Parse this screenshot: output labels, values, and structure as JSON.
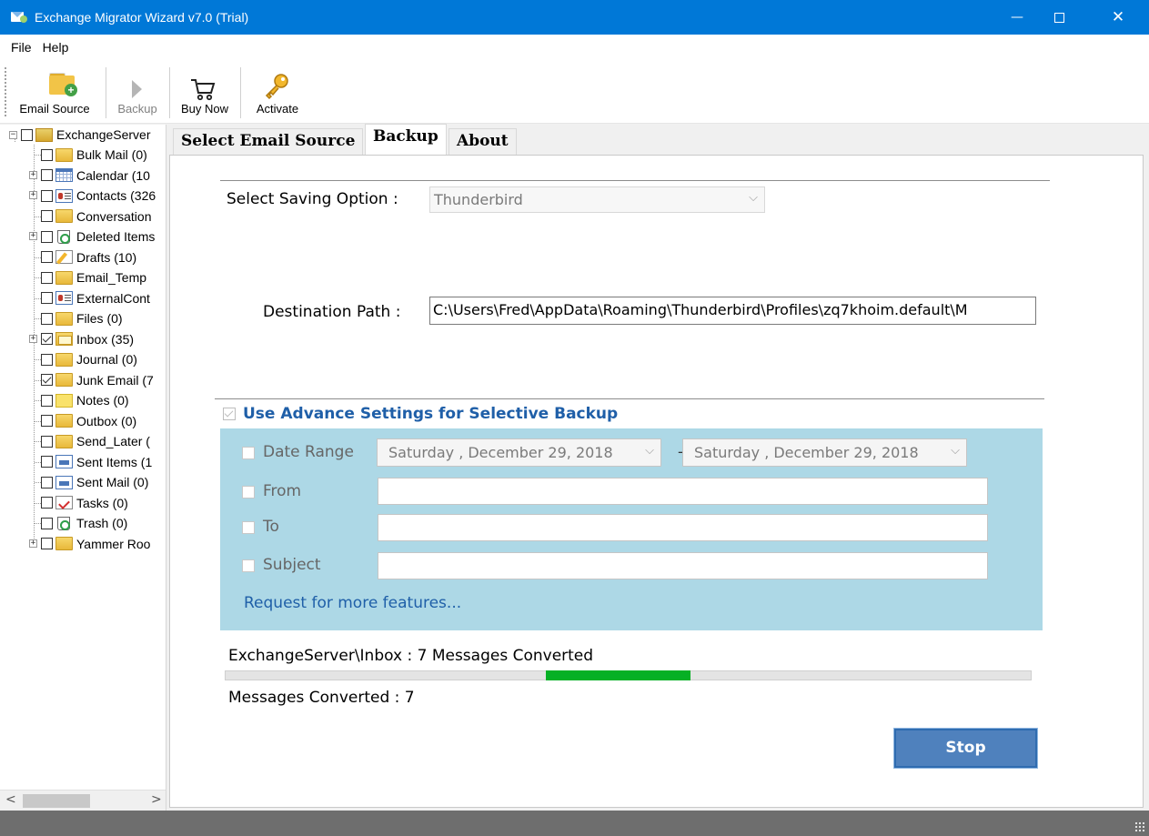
{
  "window": {
    "title": "Exchange Migrator Wizard v7.0 (Trial)",
    "accent_color": "#0078d7"
  },
  "menu": [
    "File",
    "Help"
  ],
  "toolbar": {
    "email_source": "Email Source",
    "backup": "Backup",
    "buy_now": "Buy Now",
    "activate": "Activate"
  },
  "tree": {
    "root": "ExchangeServer",
    "items": [
      {
        "label": "Bulk Mail (0)",
        "icon": "folder-icon",
        "checked": false
      },
      {
        "label": "Calendar (10",
        "icon": "calendar-icon",
        "checked": false
      },
      {
        "label": "Contacts (326",
        "icon": "contacts-icon",
        "checked": false
      },
      {
        "label": "Conversation",
        "icon": "folder-icon",
        "checked": false
      },
      {
        "label": "Deleted Items",
        "icon": "trash-icon",
        "checked": false
      },
      {
        "label": "Drafts (10)",
        "icon": "drafts-icon",
        "checked": false
      },
      {
        "label": "Email_Temp",
        "icon": "folder-icon",
        "checked": false
      },
      {
        "label": "ExternalCont",
        "icon": "contacts-icon",
        "checked": false
      },
      {
        "label": "Files (0)",
        "icon": "folder-icon",
        "checked": false
      },
      {
        "label": "Inbox (35)",
        "icon": "inbox-icon",
        "checked": true
      },
      {
        "label": "Journal (0)",
        "icon": "folder-icon",
        "checked": false
      },
      {
        "label": "Junk Email (7",
        "icon": "folder-icon",
        "checked": true
      },
      {
        "label": "Notes (0)",
        "icon": "notes-icon",
        "checked": false
      },
      {
        "label": "Outbox (0)",
        "icon": "folder-icon",
        "checked": false
      },
      {
        "label": "Send_Later (",
        "icon": "folder-icon",
        "checked": false
      },
      {
        "label": "Sent Items (1",
        "icon": "sent-items-icon",
        "checked": false
      },
      {
        "label": "Sent Mail (0)",
        "icon": "sent-items-icon",
        "checked": false
      },
      {
        "label": "Tasks (0)",
        "icon": "tasks-icon",
        "checked": false
      },
      {
        "label": "Trash (0)",
        "icon": "trash-icon",
        "checked": false
      },
      {
        "label": "Yammer Roo",
        "icon": "folder-icon",
        "checked": false
      }
    ]
  },
  "tabs": [
    "Select Email Source",
    "Backup",
    "About"
  ],
  "backup": {
    "saving_label": "Select Saving Option :",
    "saving_value": "Thunderbird",
    "dest_label": "Destination Path :",
    "dest_value": "C:\\Users\\Fred\\AppData\\Roaming\\Thunderbird\\Profiles\\zq7khoim.default\\M",
    "advanced_label": "Use Advance Settings for Selective Backup",
    "date_range_label": "Date Range",
    "date_from": "Saturday  ,  December  29, 2018",
    "date_separator": "-",
    "date_to": "Saturday  ,  December  29, 2018",
    "from_label": "From",
    "to_label": "To",
    "subject_label": "Subject",
    "more_features_link": "Request for more features...",
    "status": "ExchangeServer\\Inbox : 7 Messages Converted",
    "progress_start": 0.398,
    "progress_end": 0.578,
    "converted_count": "Messages Converted : 7",
    "stop_label": "Stop"
  },
  "colors": {
    "advanced_panel": "#add8e6",
    "progress_fill": "#06b025",
    "link": "#1f5fa8",
    "stop_button": "#4f81bd"
  }
}
